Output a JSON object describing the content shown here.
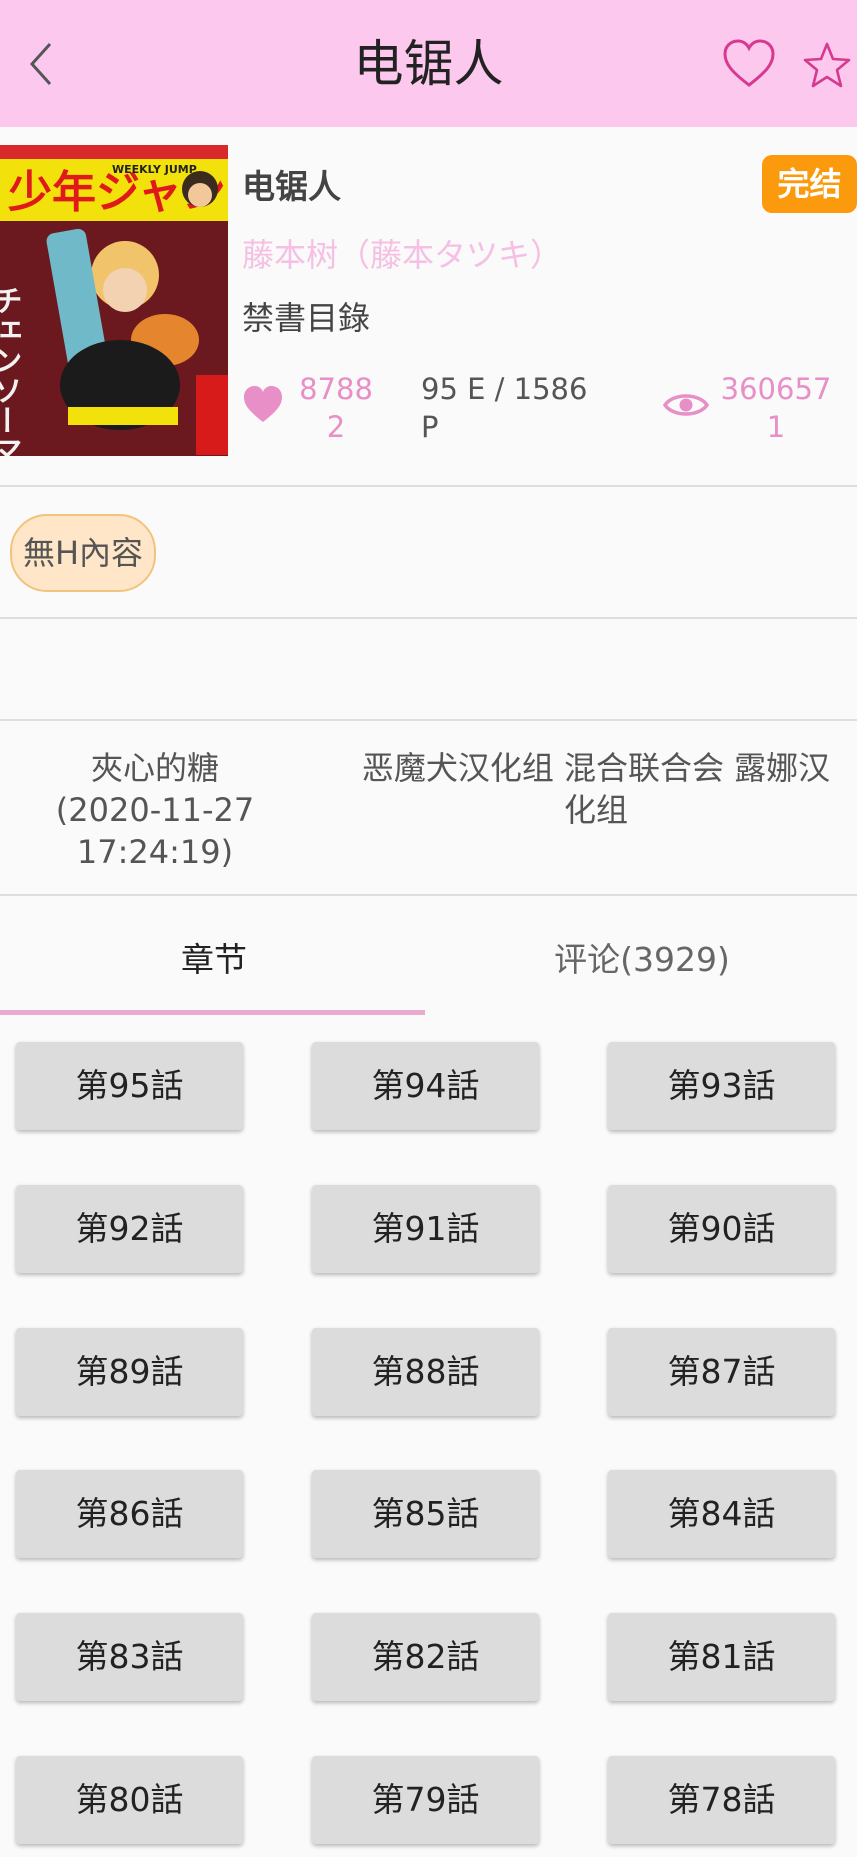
{
  "header": {
    "title": "电锯人"
  },
  "comic": {
    "title": "电锯人",
    "status": "完结",
    "author": "藤本树（藤本タツキ）",
    "publisher": "禁書目錄",
    "likes": "87882",
    "episodes": "95 E / 1586 P",
    "views": "3606571",
    "cover_text": {
      "jp": "少年ジャンプ",
      "en": "WEEKLY JUMP",
      "side": "チェンソーマン"
    }
  },
  "tags": [
    "無H內容"
  ],
  "uploader": {
    "name": "夾心的糖",
    "date": "(2020-11-27 17:24:19)"
  },
  "groups": "恶魔犬汉化组 混合联合会 露娜汉化组",
  "tabs": {
    "chapters": "章节",
    "comments": "评论(3929)"
  },
  "chapters": [
    "第95話",
    "第94話",
    "第93話",
    "第92話",
    "第91話",
    "第90話",
    "第89話",
    "第88話",
    "第87話",
    "第86話",
    "第85話",
    "第84話",
    "第83話",
    "第82話",
    "第81話",
    "第80話",
    "第79話",
    "第78話"
  ],
  "colors": {
    "header_bg": "#fdc8ee",
    "accent_pink": "#e78fc6",
    "status_orange": "#fb9a0c",
    "chapter_bg": "#dcdcdc"
  }
}
